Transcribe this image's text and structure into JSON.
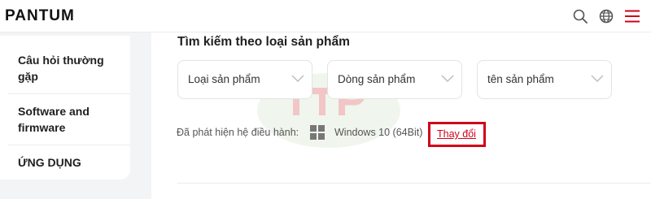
{
  "header": {
    "logo": "PANTUM",
    "icons": [
      "search-icon",
      "globe-icon",
      "menu-icon"
    ],
    "accent_color": "#d0021b"
  },
  "sidebar": {
    "items": [
      {
        "label": "Câu hỏi thường gặp"
      },
      {
        "label": "Software and firmware"
      },
      {
        "label": "ỨNG DỤNG"
      }
    ]
  },
  "main": {
    "title": "Tìm kiếm theo loại sản phẩm",
    "selects": [
      {
        "label": "Loại sản phẩm"
      },
      {
        "label": "Dòng sản phẩm"
      },
      {
        "label": "tên sản phẩm"
      }
    ],
    "os": {
      "label": "Đã phát hiện hệ điều hành:",
      "value": "Windows 10 (64Bit)",
      "icon": "windows-icon",
      "change_label": "Thay đổi"
    }
  }
}
